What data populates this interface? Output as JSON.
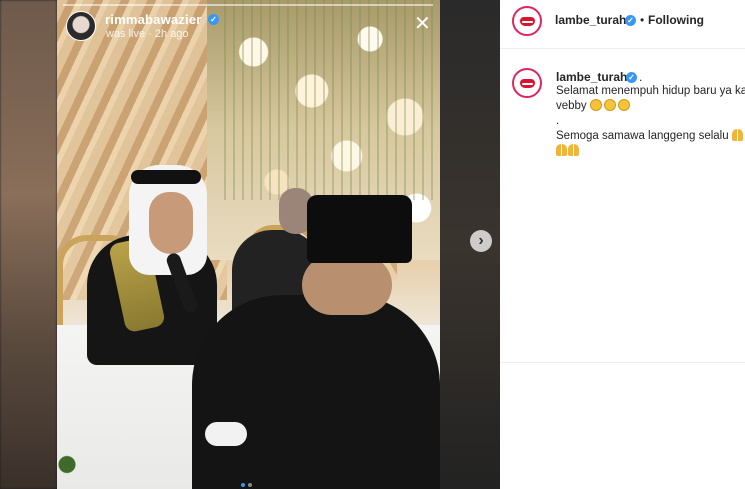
{
  "story": {
    "username": "rimmabawazier",
    "status": "was live · 2h ago",
    "close_icon": "close-icon",
    "next_icon": "chevron-right-icon"
  },
  "post": {
    "author": "lambe_turah",
    "follow_separator": "•",
    "follow_status": "Following",
    "caption_author": "lambe_turah",
    "caption_dot": ".",
    "caption_lines": [
      "Selamat menempuh hidup baru ya ka",
      "vebby",
      ".",
      "Semoga samawa langgeng selalu"
    ],
    "emoji_names": [
      "kissing-face-emoji",
      "folded-hands-emoji"
    ]
  },
  "colors": {
    "verified_blue": "#3897f0",
    "avatar_ring": "#e0245e",
    "lips_red": "#d8142e"
  }
}
